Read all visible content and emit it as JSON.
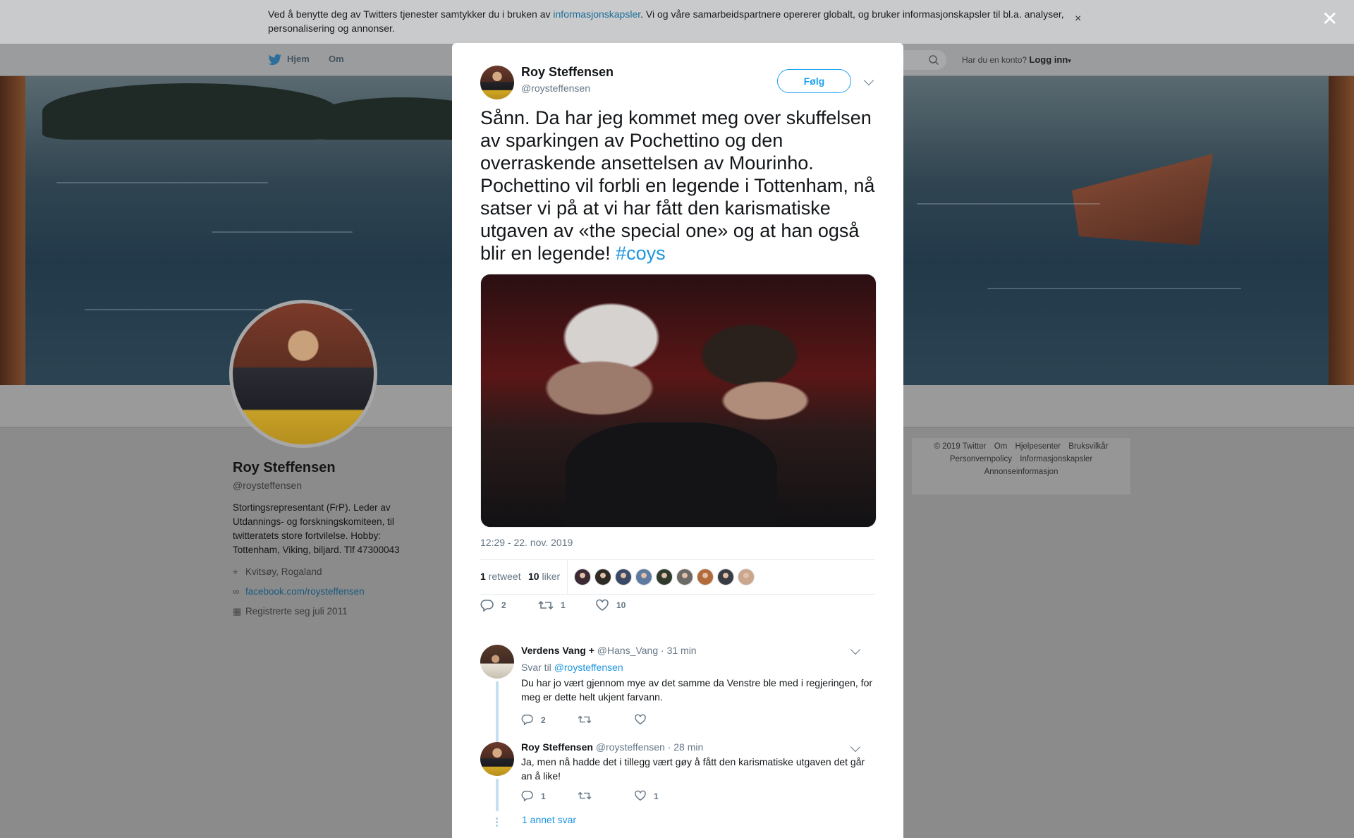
{
  "cookie": {
    "text_before": "Ved å benytte deg av Twitters tjenester samtykker du i bruken av ",
    "link": "informasjonskapsler",
    "text_after": ". Vi og våre samarbeidspartnere opererer globalt, og bruker informasjonskapsler til bl.a. analyser, personalisering og annonser.",
    "close": "×"
  },
  "nav": {
    "home": "Hjem",
    "about": "Om",
    "login_prompt": "Har du en konto?",
    "login": "Logg inn"
  },
  "profile": {
    "name": "Roy Steffensen",
    "handle": "@roysteffensen",
    "bio": "Stortingsrepresentant (FrP). Leder av Utdannings- og forskningskomiteen, til twitteratets store fortvilelse. Hobby: Tottenham, Viking, biljard. Tlf 47300043",
    "location": "Kvitsøy, Rogaland",
    "website": "facebook.com/roysteffensen",
    "joined": "Registrerte seg juli 2011"
  },
  "footer": {
    "row1": [
      "© 2019 Twitter",
      "Om",
      "Hjelpesenter",
      "Bruksvilkår"
    ],
    "row2": [
      "Personvernpolicy",
      "Informasjonskapsler"
    ],
    "row3": [
      "Annonseinformasjon"
    ]
  },
  "overlay_close": "✕",
  "tweet": {
    "author_name": "Roy Steffensen",
    "author_handle": "@roysteffensen",
    "follow_label": "Følg",
    "text": "Sånn. Da har jeg kommet meg over skuffelsen av sparkingen av Pochettino og den overraskende ansettelsen av Mourinho. Pochettino vil forbli en legende i Tottenham, nå satser vi på at vi har fått den karismatiske utgaven av «the special one» og at han også blir en legende! ",
    "hashtag": "#coys",
    "timestamp": "12:29 - 22. nov. 2019",
    "retweets_count": "1",
    "retweets_label": " retweet",
    "likes_count": "10",
    "likes_label": " liker",
    "reply_count": "2",
    "retweet_action_count": "1",
    "like_action_count": "10"
  },
  "liker_face_colors": [
    "#3b2a33",
    "#2e2a24",
    "#3a4a66",
    "#5e7aa0",
    "#2f3a2c",
    "#6c6a66",
    "#b26a3a",
    "#3a3c44",
    "#caa68c"
  ],
  "replies": [
    {
      "name": "Verdens Vang +",
      "handle": "@Hans_Vang",
      "time": "· 31 min",
      "reply_to_label": "Svar til",
      "reply_to_handle": "@roysteffensen",
      "text": "Du har jo vært gjennom mye av det samme da Venstre ble med i regjeringen, for meg er dette helt ukjent farvann.",
      "reply_count": "2",
      "retweet_count": "",
      "like_count": ""
    },
    {
      "name": "Roy Steffensen",
      "handle": "@roysteffensen",
      "time": "· 28 min",
      "text": "Ja, men nå hadde det i tillegg vært gøy å fått den karismatiske utgaven det går an å like!",
      "reply_count": "1",
      "retweet_count": "",
      "like_count": "1"
    }
  ],
  "more_replies": "1 annet svar"
}
